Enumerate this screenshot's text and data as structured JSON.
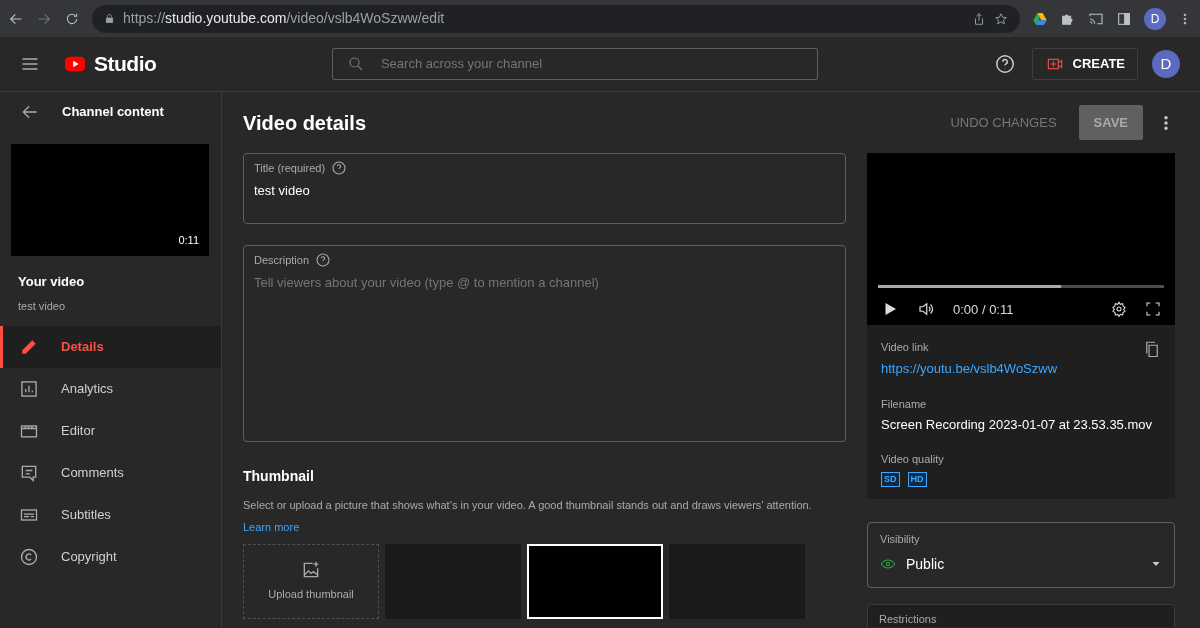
{
  "browser": {
    "url": "https://**studio.youtube.com**/video/vslb4WoSzww/edit",
    "avatar": "D"
  },
  "header": {
    "logo_text": "Studio",
    "search_placeholder": "Search across your channel",
    "create_label": "CREATE",
    "avatar": "D"
  },
  "sidebar": {
    "back_label": "Channel content",
    "duration": "0:11",
    "video_heading": "Your video",
    "video_title": "test video",
    "items": [
      {
        "label": "Details",
        "kind": "pencil",
        "selected": true
      },
      {
        "label": "Analytics",
        "kind": "chart",
        "selected": false
      },
      {
        "label": "Editor",
        "kind": "clapper",
        "selected": false
      },
      {
        "label": "Comments",
        "kind": "comment",
        "selected": false
      },
      {
        "label": "Subtitles",
        "kind": "subtitles",
        "selected": false
      },
      {
        "label": "Copyright",
        "kind": "copyright",
        "selected": false
      }
    ]
  },
  "main": {
    "heading": "Video details",
    "undo_label": "UNDO CHANGES",
    "save_label": "SAVE",
    "title_field": {
      "label": "Title (required)",
      "value": "test video"
    },
    "description_field": {
      "label": "Description",
      "placeholder": "Tell viewers about your video (type @ to mention a channel)"
    },
    "thumbnail": {
      "heading": "Thumbnail",
      "text": "Select or upload a picture that shows what’s in your video. A good thumbnail stands out and draws viewers’ attention.",
      "learn_more": "Learn more",
      "upload_label": "Upload thumbnail",
      "options": [
        {
          "selected": false
        },
        {
          "selected": true
        },
        {
          "selected": false
        }
      ]
    }
  },
  "details": {
    "player": {
      "time": "0:00 / 0:11",
      "level": 0.64
    },
    "link_label": "Video link",
    "link": "https://youtu.be/vslb4WoSzww",
    "filename_label": "Filename",
    "filename": "Screen Recording 2023-01-07 at 23.53.35.mov",
    "quality_label": "Video quality",
    "qualities": [
      "SD",
      "HD"
    ],
    "visibility_label": "Visibility",
    "visibility": "Public",
    "restrictions_label": "Restrictions"
  }
}
